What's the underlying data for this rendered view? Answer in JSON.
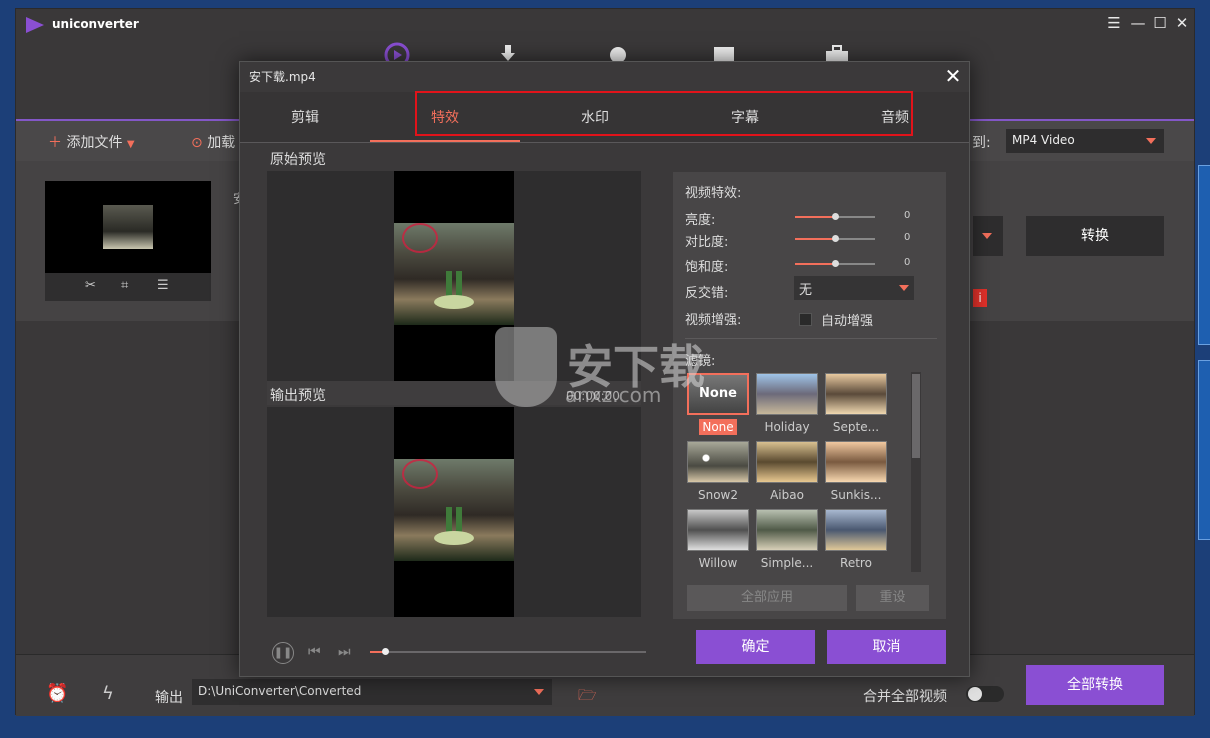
{
  "app": {
    "title": "uniconverter"
  },
  "toolbar": {
    "add_files": "添加文件",
    "load": "加载",
    "output_format_label": "到:",
    "output_format": "MP4 Video"
  },
  "main": {
    "convert": "转换",
    "file_title_partial": "安"
  },
  "bottom": {
    "output_label": "输出",
    "output_path": "D:\\UniConverter\\Converted",
    "merge_all": "合并全部视频",
    "convert_all": "全部转换"
  },
  "dialog": {
    "title": "安下载.mp4",
    "tabs": [
      "剪辑",
      "特效",
      "水印",
      "字幕",
      "音频"
    ],
    "active_tab": "特效",
    "original_preview": "原始预览",
    "output_preview": "输出预览",
    "effects": {
      "header": "视频特效:",
      "brightness": {
        "label": "亮度:",
        "value": "0"
      },
      "contrast": {
        "label": "对比度:",
        "value": "0"
      },
      "saturation": {
        "label": "饱和度:",
        "value": "0"
      },
      "deinterlace": {
        "label": "反交错:",
        "value": "无"
      },
      "enhance": {
        "label": "视频增强:",
        "checkbox": "自动增强"
      },
      "filters_label": "滤镜:",
      "filters": [
        "None",
        "Holiday",
        "Septe...",
        "Snow2",
        "Aibao",
        "Sunkis...",
        "Willow",
        "Simple...",
        "Retro"
      ],
      "selected_filter": "None",
      "apply_all": "全部应用",
      "reset": "重设"
    },
    "ok": "确定",
    "cancel": "取消",
    "timecode": "00:00:00"
  },
  "watermark": {
    "text": "安下载",
    "sub": "anxz.com"
  },
  "colors": {
    "accent": "#8a4fd3",
    "active_tab": "#f36f5b",
    "highlight_box": "#e2131a"
  }
}
